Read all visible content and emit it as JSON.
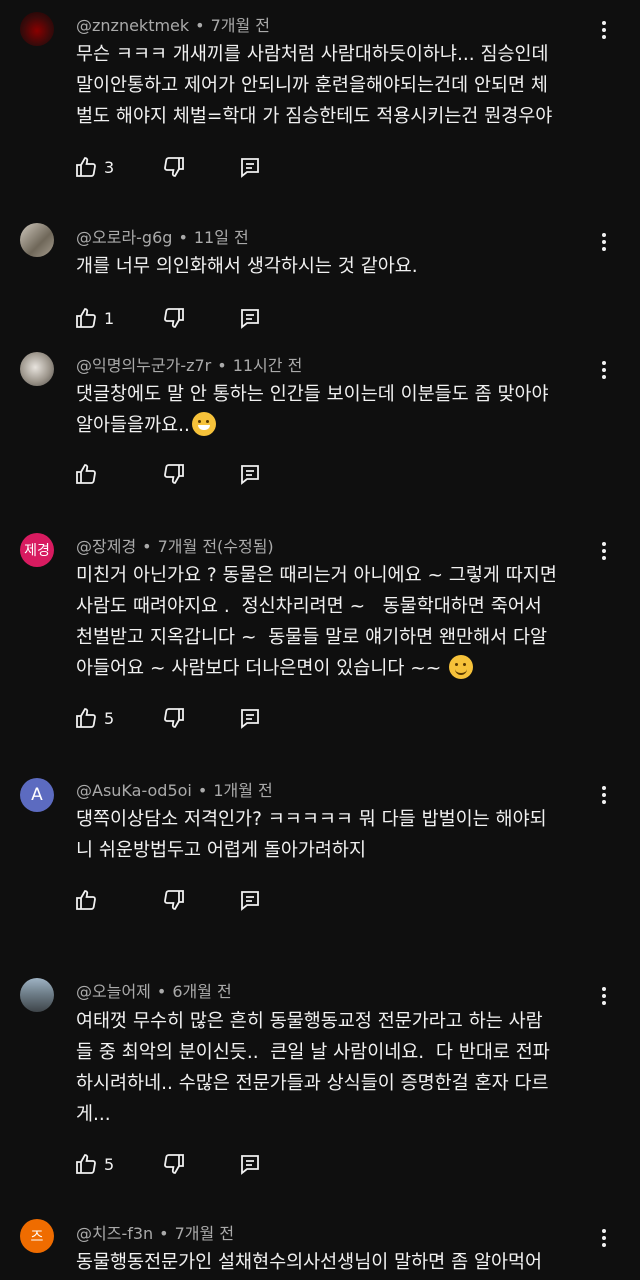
{
  "comments": [
    {
      "author": "@znznektmek",
      "time": "7개월 전",
      "lines": [
        "무슨 ㅋㅋㅋ 개새끼를 사람처럼 사람대하듯이하냐... 짐승인데",
        "말이안통하고 제어가 안되니까 훈련을해야되는건데 안되면 체",
        "벌도 해야지 체벌=학대 가 짐승한테도 적용시키는건 뭔경우야"
      ],
      "likes": "3",
      "avatar_color": "#3a0a0a"
    },
    {
      "author": "@오로라-g6g",
      "time": "11일 전",
      "lines": [
        "개를 너무 의인화해서 생각하시는 것 같아요."
      ],
      "likes": "1",
      "avatar_color": "#8c8478"
    },
    {
      "author": "@익명의누군가-z7r",
      "time": "11시간 전",
      "lines": [
        "댓글창에도 말 안 통하는 인간들 보이는데 이분들도 좀 맞아야",
        "알아들을까요.."
      ],
      "likes": "",
      "avatar_color": "#b9b4ae"
    },
    {
      "author": "@장제경",
      "time": "7개월 전(수정됨)",
      "lines": [
        "미친거 아닌가요 ? 동물은 때리는거 아니에요 ~ 그렇게 따지면",
        "사람도 때려야지요 .  정신차리려면 ~   동물학대하면 죽어서",
        "천벌받고 지옥갑니다 ~  동물들 말로 얘기하면 왠만해서 다알",
        "아들어요 ~ 사람보다 더나은면이 있습니다 ~~ "
      ],
      "likes": "5",
      "avatar_text": "제경",
      "avatar_color": "#d81b60"
    },
    {
      "author": "@AsuKa-od5oi",
      "time": "1개월 전",
      "lines": [
        "댕쪽이상담소 저격인가? ㅋㅋㅋㅋㅋ 뭐 다들 밥벌이는 해야되",
        "니 쉬운방법두고 어렵게 돌아가려하지"
      ],
      "likes": "",
      "avatar_text": "A",
      "avatar_color": "#5c6bc0"
    },
    {
      "author": "@오늘어제",
      "time": "6개월 전",
      "lines": [
        "여태껏 무수히 많은 흔히 동물행동교정 전문가라고 하는 사람",
        "들 중 최악의 분이신듯..  큰일 날 사람이네요.  다 반대로 전파",
        "하시려하네.. 수많은 전문가들과 상식들이 증명한걸 혼자 다르",
        "게..."
      ],
      "likes": "5",
      "avatar_color": "#6f7f8a"
    },
    {
      "author": "@치즈-f3n",
      "time": "7개월 전",
      "lines": [
        "동물행동전문가인 설채현수의사선생님이 말하면 좀 알아먹어"
      ],
      "likes": "",
      "avatar_text": "즈",
      "avatar_color": "#ef6c00"
    }
  ],
  "icons": {
    "like": "thumbs-up-icon",
    "dislike": "thumbs-down-icon",
    "reply": "reply-icon",
    "more": "more-vertical-icon",
    "emoji_sweat": "grinning-sweat-emoji",
    "emoji_smile": "smiling-emoji"
  }
}
